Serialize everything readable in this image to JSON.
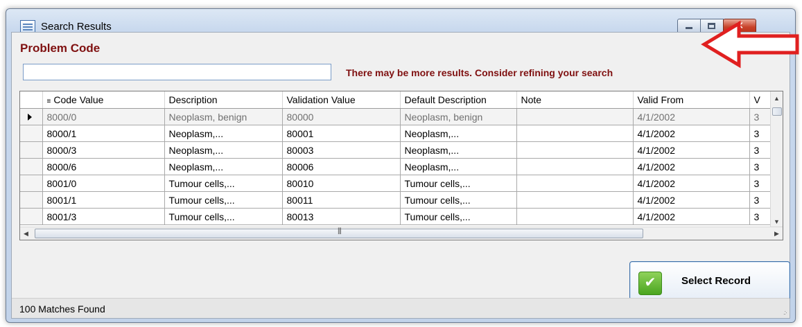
{
  "window": {
    "title": "Search Results",
    "min_icon": "minimize-icon",
    "max_icon": "maximize-icon",
    "close_glyph": "✕"
  },
  "form": {
    "heading": "Problem Code",
    "search_value": "",
    "warning": "There may be more results. Consider refining your search",
    "accent_color": "#7f1010"
  },
  "grid": {
    "columns": [
      "Code Value",
      "Description",
      "Validation Value",
      "Default Description",
      "Note",
      "Valid From",
      "V"
    ],
    "rows": [
      [
        "8000/0",
        "Neoplasm, benign",
        "80000",
        "Neoplasm, benign",
        "",
        "4/1/2002",
        "3"
      ],
      [
        "8000/1",
        "Neoplasm,...",
        "80001",
        "Neoplasm,...",
        "",
        "4/1/2002",
        "3"
      ],
      [
        "8000/3",
        "Neoplasm,...",
        "80003",
        "Neoplasm,...",
        "",
        "4/1/2002",
        "3"
      ],
      [
        "8000/6",
        "Neoplasm,...",
        "80006",
        "Neoplasm,...",
        "",
        "4/1/2002",
        "3"
      ],
      [
        "8001/0",
        "Tumour cells,...",
        "80010",
        "Tumour cells,...",
        "",
        "4/1/2002",
        "3"
      ],
      [
        "8001/1",
        "Tumour cells,...",
        "80011",
        "Tumour cells,...",
        "",
        "4/1/2002",
        "3"
      ],
      [
        "8001/3",
        "Tumour cells,...",
        "80013",
        "Tumour cells,...",
        "",
        "4/1/2002",
        "3"
      ]
    ],
    "selected_row": 0
  },
  "actions": {
    "select_label": "Select Record",
    "select_color": "#4aa520"
  },
  "status": {
    "text": "100 Matches Found"
  },
  "annotation": {
    "arrow_color": "#e02020"
  }
}
